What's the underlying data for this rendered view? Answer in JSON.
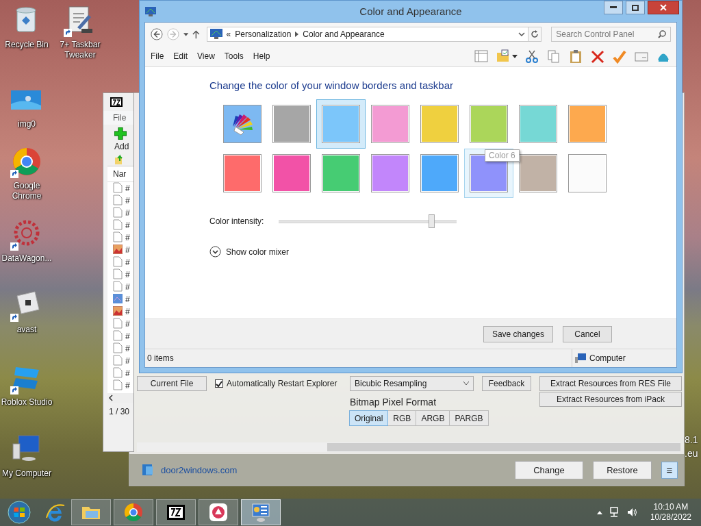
{
  "desktop_icons": [
    {
      "label": "Recycle Bin",
      "kind": "recycle",
      "shortcut": false
    },
    {
      "label": "7+ Taskbar Tweaker",
      "kind": "tweaker",
      "shortcut": true
    },
    {
      "label": "img0",
      "kind": "image",
      "shortcut": false
    },
    {
      "label": "Google Chrome",
      "kind": "chrome",
      "shortcut": true
    },
    {
      "label": "DataWagon...",
      "kind": "gear",
      "shortcut": true
    },
    {
      "label": "avast",
      "kind": "cube",
      "shortcut": true
    },
    {
      "label": "Roblox Studio",
      "kind": "studio",
      "shortcut": true
    },
    {
      "label": "My Computer",
      "kind": "computer",
      "shortcut": false
    }
  ],
  "zip_window": {
    "menu": "File",
    "toolbar_button": "Add",
    "column": "Nar",
    "rows": [
      {
        "kind": "doc",
        "text": "#"
      },
      {
        "kind": "doc",
        "text": "#"
      },
      {
        "kind": "doc",
        "text": "#"
      },
      {
        "kind": "doc",
        "text": "#"
      },
      {
        "kind": "doc",
        "text": "#"
      },
      {
        "kind": "image",
        "text": "#"
      },
      {
        "kind": "doc",
        "text": "#"
      },
      {
        "kind": "doc",
        "text": "#"
      },
      {
        "kind": "doc",
        "text": "#"
      },
      {
        "kind": "blue",
        "text": "#"
      },
      {
        "kind": "image",
        "text": "#"
      },
      {
        "kind": "doc",
        "text": "#"
      },
      {
        "kind": "doc",
        "text": "#"
      },
      {
        "kind": "doc",
        "text": "#"
      },
      {
        "kind": "doc",
        "text": "#"
      },
      {
        "kind": "doc",
        "text": "#"
      },
      {
        "kind": "doc",
        "text": "#"
      }
    ],
    "status": "1 / 30"
  },
  "tweaker_window": {
    "current_file_button": "Current File",
    "restart_checkbox": {
      "label": "Automatically Restart Explorer",
      "checked": true
    },
    "resampling_dropdown": "Bicubic Resampling",
    "feedback_button": "Feedback",
    "extract_buttons": [
      "Extract Resources from RES File",
      "Extract Resources from iPack"
    ],
    "pixel_format": {
      "label": "Bitmap Pixel Format",
      "options": [
        {
          "label": "Original",
          "selected": true
        },
        {
          "label": "RGB",
          "selected": false
        },
        {
          "label": "ARGB",
          "selected": false
        },
        {
          "label": "PARGB",
          "selected": false
        }
      ]
    },
    "link": "door2windows.com",
    "buttons": [
      "Change",
      "Restore"
    ],
    "menu_button": "≡"
  },
  "edge_texts": [
    "8.1",
    ".eu"
  ],
  "window": {
    "title": "Color and Appearance",
    "address": {
      "prefix": "«",
      "path": [
        "Personalization",
        "Color and Appearance"
      ]
    },
    "search": {
      "placeholder": "Search Control Panel"
    },
    "menu": [
      "File",
      "Edit",
      "View",
      "Tools",
      "Help"
    ],
    "heading": "Change the color of your window borders and taskbar",
    "swatches": [
      {
        "kind": "palette",
        "selected": false,
        "hovered": false
      },
      {
        "kind": "color",
        "color": "#a6a6a6",
        "selected": false,
        "hovered": false
      },
      {
        "kind": "color",
        "color": "#7cc6fa",
        "selected": true,
        "hovered": false
      },
      {
        "kind": "color",
        "color": "#f39bd3",
        "selected": false,
        "hovered": false
      },
      {
        "kind": "color",
        "color": "#efd03f",
        "selected": false,
        "hovered": false
      },
      {
        "kind": "color",
        "color": "#abd65a",
        "selected": false,
        "hovered": false
      },
      {
        "kind": "color",
        "color": "#76d8d5",
        "selected": false,
        "hovered": false
      },
      {
        "kind": "color",
        "color": "#fda94e",
        "selected": false,
        "hovered": false
      },
      {
        "kind": "color",
        "color": "#fe6b6b",
        "selected": false,
        "hovered": false
      },
      {
        "kind": "color",
        "color": "#f252a7",
        "selected": false,
        "hovered": false
      },
      {
        "kind": "color",
        "color": "#46cc73",
        "selected": false,
        "hovered": false
      },
      {
        "kind": "color",
        "color": "#c286fb",
        "selected": false,
        "hovered": false
      },
      {
        "kind": "color",
        "color": "#4ea9fa",
        "selected": false,
        "hovered": false
      },
      {
        "kind": "color",
        "color": "#8f92fb",
        "selected": false,
        "hovered": true
      },
      {
        "kind": "color",
        "color": "#c1b2a6",
        "selected": false,
        "hovered": false
      },
      {
        "kind": "color",
        "color": "#fbfbfb",
        "selected": false,
        "hovered": false
      }
    ],
    "tooltip": "Color 6",
    "intensity": {
      "label": "Color intensity:",
      "level": 0.86
    },
    "mixer": {
      "label": "Show color mixer",
      "expanded": false
    },
    "buttons": [
      "Save changes",
      "Cancel"
    ],
    "status_bar": {
      "items": "0 items",
      "location": "Computer"
    }
  },
  "taskbar": {
    "apps": [
      {
        "kind": "ie",
        "running": false,
        "selected": false
      },
      {
        "kind": "explorer",
        "running": true,
        "selected": false
      },
      {
        "kind": "chrome",
        "running": true,
        "selected": false
      },
      {
        "kind": "sevenzip",
        "running": true,
        "selected": false
      },
      {
        "kind": "gear",
        "running": true,
        "selected": false
      },
      {
        "kind": "controlpanel",
        "running": true,
        "selected": true
      }
    ],
    "clock": {
      "time": "10:10 AM",
      "date": "10/28/2022"
    }
  }
}
